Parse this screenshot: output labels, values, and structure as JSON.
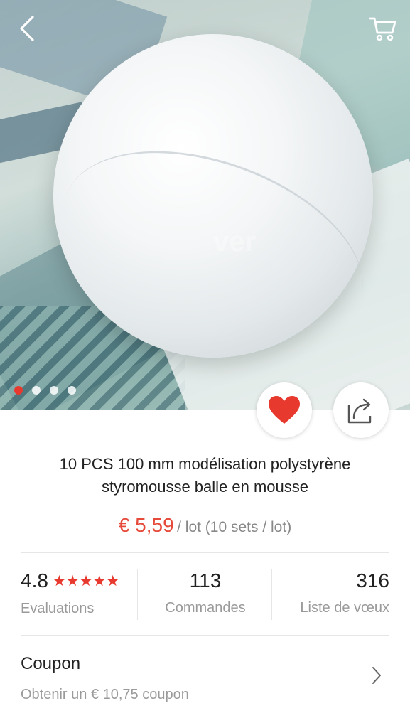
{
  "header": {
    "back_icon": "chevron-left-icon",
    "cart_icon": "cart-icon"
  },
  "gallery": {
    "watermark": "ver",
    "image_count": 4,
    "active_index": 0,
    "wishlist_icon": "heart-icon",
    "share_icon": "share-icon",
    "wishlist_color": "#e8392f"
  },
  "product": {
    "title_line1": "10 PCS 100 mm modélisation polystyrène",
    "title_line2": "styromousse balle en mousse",
    "price": "€ 5,59",
    "unit": "/ lot (10 sets / lot)",
    "price_color": "#e64a3b"
  },
  "stats": {
    "rating": "4.8",
    "rating_stars": 5,
    "rating_label": "Evaluations",
    "orders": "113",
    "orders_label": "Commandes",
    "wishlist": "316",
    "wishlist_label": "Liste de vœux"
  },
  "coupon": {
    "title": "Coupon",
    "subtitle": "Obtenir un € 10,75 coupon",
    "chevron_icon": "chevron-right-icon"
  }
}
